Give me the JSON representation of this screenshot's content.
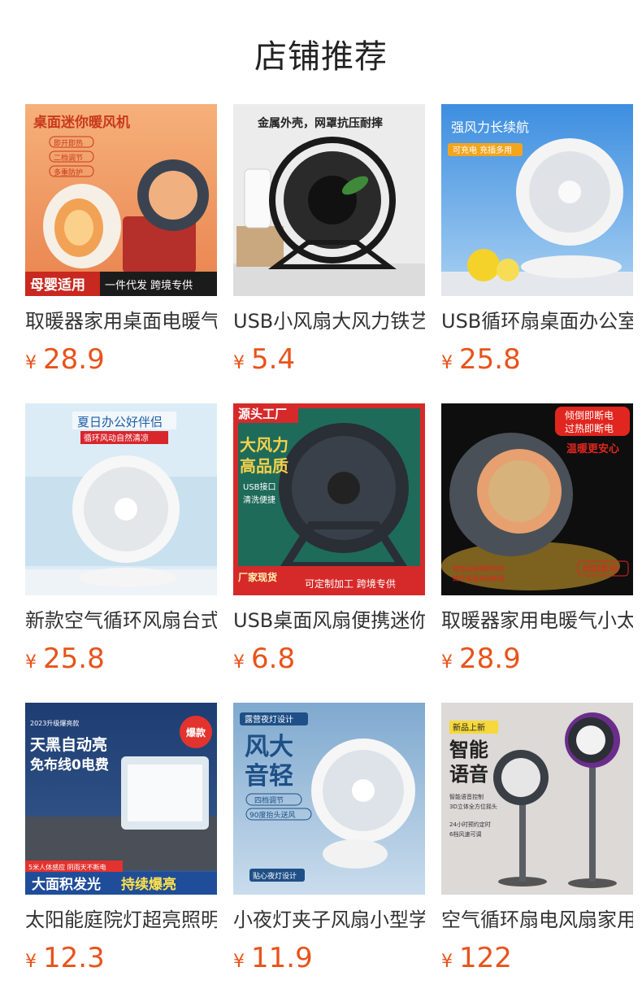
{
  "page_title": "店铺推荐",
  "currency_symbol": "¥",
  "products": [
    {
      "title": "取暖器家用桌面电暖气",
      "price": "28.9",
      "image_texts": [
        "桌面迷你暖风机",
        "即开即热",
        "二档调节",
        "多重防护",
        "母婴适用",
        "一件代发 跨境专供"
      ]
    },
    {
      "title": "USB小风扇大风力铁艺",
      "price": "5.4",
      "image_texts": [
        "金属外壳，网罩抗压耐摔"
      ]
    },
    {
      "title": "USB循环扇桌面办公室",
      "price": "25.8",
      "image_texts": [
        "强风力长续航",
        "可充电 充插多用"
      ]
    },
    {
      "title": "新款空气循环风扇台式",
      "price": "25.8",
      "image_texts": [
        "夏日办公好伴侣",
        "循环风动自然清凉"
      ]
    },
    {
      "title": "USB桌面风扇便携迷你",
      "price": "6.8",
      "image_texts": [
        "源头工厂",
        "大风力",
        "高品质",
        "USB接口",
        "清洗便捷",
        "厂家现货",
        "可定制加工 跨境专供"
      ]
    },
    {
      "title": "取暖器家用电暖气小太阳",
      "price": "28.9",
      "image_texts": [
        "倾倒即断电",
        "过热即断电",
        "温暖更安心",
        "底部设有倾倒开关",
        "离开桌面自动断电",
        "倾斜断电"
      ]
    },
    {
      "title": "太阳能庭院灯超亮照明",
      "price": "12.3",
      "image_texts": [
        "2023升级爆亮款",
        "爆款",
        "天黑自动亮",
        "免布线0电费",
        "5米人体感应 阴雨天不断电",
        "大面积发光",
        "持续爆亮"
      ]
    },
    {
      "title": "小夜灯夹子风扇小型学生",
      "price": "11.9",
      "image_texts": [
        "露营夜灯设计",
        "风大",
        "音轻",
        "四档调节",
        "90度抬头送风",
        "贴心夜灯设计"
      ]
    },
    {
      "title": "空气循环扇电风扇家用落地",
      "price": "122",
      "image_texts": [
        "新品上新",
        "智能",
        "语音",
        "智能语音控制",
        "3D立体全方位摇头",
        "24小时预约定时",
        "6档风速可调"
      ]
    }
  ]
}
